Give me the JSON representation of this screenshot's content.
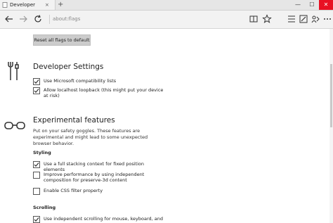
{
  "tab": {
    "title": "Developer settings",
    "close": "×",
    "new_tab": "+"
  },
  "window": {
    "minimize": "—",
    "maximize": "☐",
    "close": "✕"
  },
  "address": {
    "url": "about:flags"
  },
  "reset_button": "Reset all flags to default",
  "developer_settings": {
    "title": "Developer Settings",
    "options": [
      {
        "label": "Use Microsoft compatibility lists",
        "checked": true
      },
      {
        "label": "Allow localhost loopback (this might put your device at risk)",
        "checked": true
      }
    ]
  },
  "experimental": {
    "title": "Experimental features",
    "description": "Put on your safety goggles. These features are experimental and might lead to some unexpected browser behavior.",
    "styling": {
      "heading": "Styling",
      "options": [
        {
          "label": "Use a full stacking context for fixed position elements",
          "checked": true
        },
        {
          "label": "Improve performance by using independent composition for preserve-3d content",
          "checked": false
        },
        {
          "label": "Enable CSS filter property",
          "checked": false
        }
      ]
    },
    "scrolling": {
      "heading": "Scrolling",
      "options": [
        {
          "label": "Use independent scrolling for mouse, keyboard, and",
          "checked": true
        }
      ]
    }
  },
  "icons": [
    "back-icon",
    "forward-icon",
    "refresh-icon",
    "reading-view-icon",
    "favorite-icon",
    "hub-icon",
    "web-note-icon",
    "share-icon",
    "more-icon",
    "wrench-icon",
    "goggles-icon"
  ]
}
